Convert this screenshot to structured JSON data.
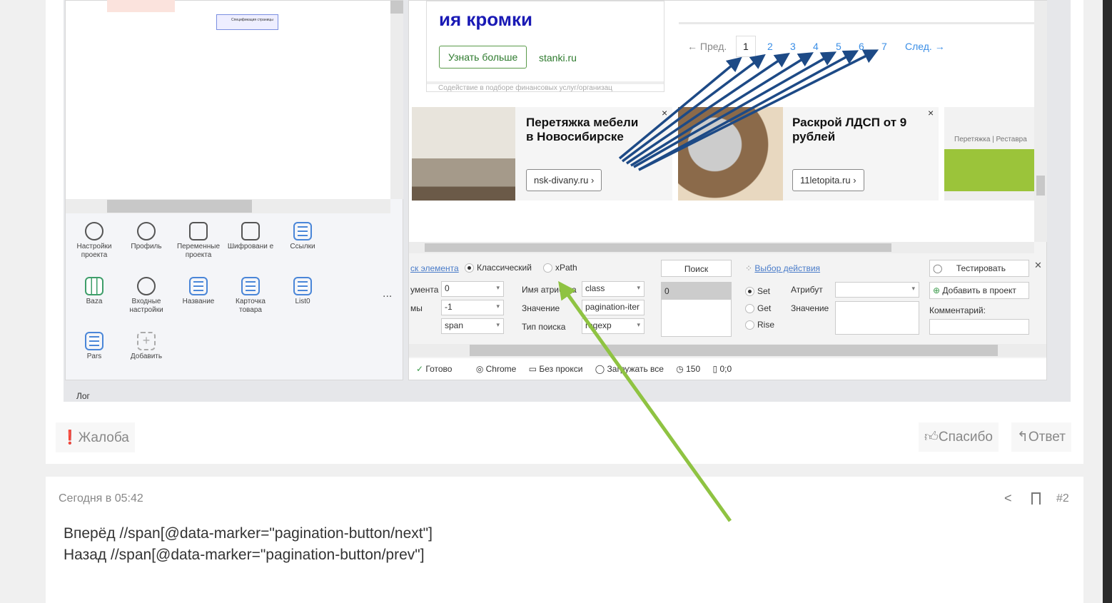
{
  "embedded_screenshot": {
    "left_panel": {
      "mini_widget_text": "Спецификация страницы",
      "tools": [
        {
          "label": "Настройки проекта",
          "icon": "gear-icon"
        },
        {
          "label": "Профиль",
          "icon": "profile-icon"
        },
        {
          "label": "Переменные проекта",
          "icon": "grid-icon"
        },
        {
          "label": "Шифровани е",
          "icon": "lock-icon"
        },
        {
          "label": "Ссылки",
          "icon": "list-icon"
        },
        {
          "label": "Baza",
          "icon": "table-icon"
        },
        {
          "label": "Входные настройки",
          "icon": "branch-icon"
        },
        {
          "label": "Название",
          "icon": "list-icon"
        },
        {
          "label": "Карточка товара",
          "icon": "list-icon"
        },
        {
          "label": "List0",
          "icon": "list-icon"
        },
        {
          "label": "Pars",
          "icon": "list-icon"
        },
        {
          "label": "Добавить",
          "icon": "add-icon"
        }
      ],
      "more": "...",
      "log_label": "Лог"
    },
    "web": {
      "ad1_title": "ия кромки",
      "ad1_button": "Узнать больше",
      "ad1_domain": "stanki.ru",
      "ad1_footer": "Содействие в подборе финансовых услуг/организац",
      "pagination": {
        "prev": "← Пред.",
        "pages": [
          "1",
          "2",
          "3",
          "4",
          "5",
          "6",
          "7"
        ],
        "next": "След. →",
        "current": "1"
      },
      "ad2_title": "Перетяжка мебели в Новосибирске",
      "ad2_button": "nsk-divany.ru ›",
      "ad3_title": "Раскрой ЛДСП от 9 рублей",
      "ad3_button": "11letopita.ru ›",
      "ad4_text": "Перетяжка | Реставра",
      "close": "×"
    },
    "toolbar": {
      "search_mode_link": "ск элемента",
      "classic": "Классический",
      "xpath": "xPath",
      "row1_label": "умента",
      "row1_value": "0",
      "row2_label": "мы",
      "row2_value": "-1",
      "row3_value": "span",
      "attr_name_label": "Имя атрибута",
      "attr_name_value": "class",
      "value_label": "Значение",
      "value_value": "pagination-iter",
      "search_type_label": "Тип поиска",
      "search_type_value": "regexp",
      "search_button": "Поиск",
      "result_value": "0",
      "action_link": "Выбор действия",
      "set": "Set",
      "get": "Get",
      "rise": "Rise",
      "attribute_label": "Атрибут",
      "value2_label": "Значение",
      "test_button": "Тестировать",
      "add_button": "Добавить в проект",
      "comment_label": "Комментарий:",
      "close": "✕"
    },
    "status": {
      "ready": "Готово",
      "browser": "Chrome",
      "proxy": "Без прокси",
      "load": "Загружать все",
      "timeout": "150",
      "coords": "0;0"
    }
  },
  "post1_actions": {
    "complaint": "Жалоба",
    "thanks": "Спасибо",
    "reply": "Ответ"
  },
  "post2": {
    "timestamp": "Сегодня в 05:42",
    "number": "#2",
    "lines": [
      "Вперёд //span[@data-marker=\"pagination-button/next\"]",
      "Назад //span[@data-marker=\"pagination-button/prev\"]"
    ]
  }
}
